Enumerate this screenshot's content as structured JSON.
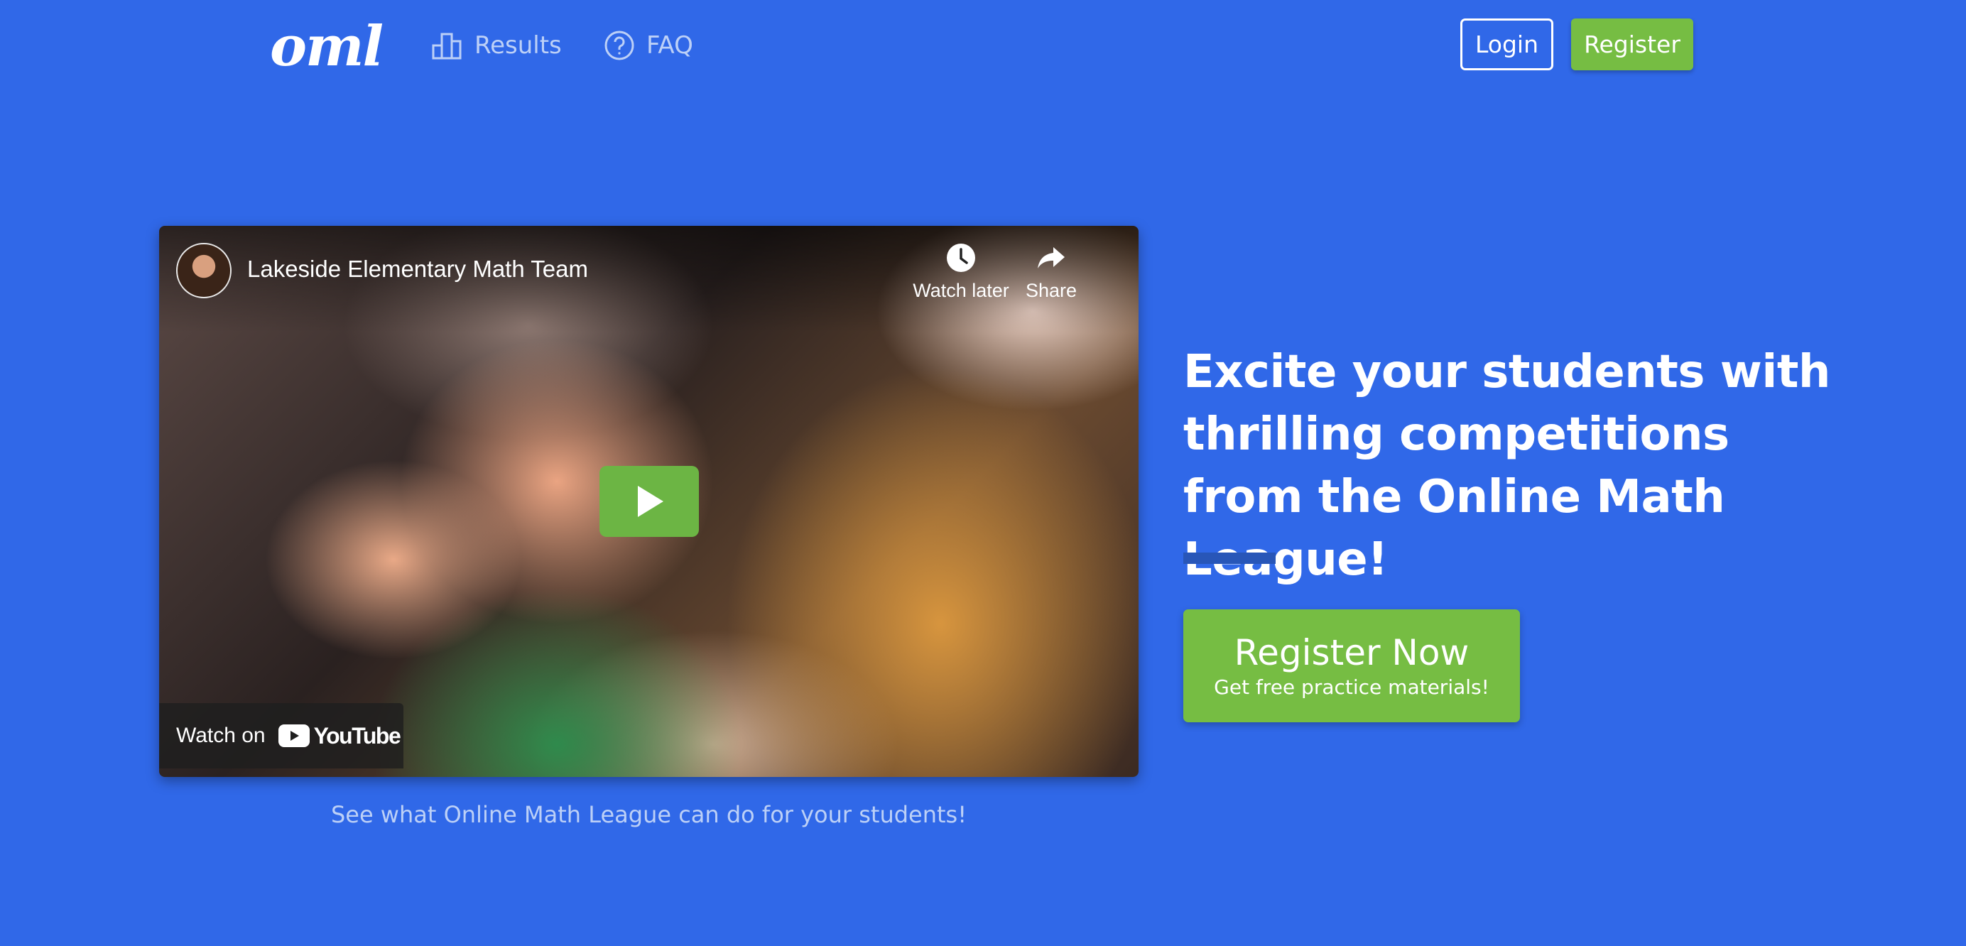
{
  "header": {
    "logo_text": "oml",
    "nav": [
      {
        "label": "Results",
        "icon": "bar-chart-icon"
      },
      {
        "label": "FAQ",
        "icon": "question-circle-icon"
      }
    ],
    "login_label": "Login",
    "register_label": "Register"
  },
  "video": {
    "channel_title": "Lakeside Elementary Math Team",
    "watch_later_label": "Watch later",
    "share_label": "Share",
    "watch_on_label": "Watch on",
    "youtube_label": "YouTube",
    "caption": "See what Online Math League can do for your students!"
  },
  "hero": {
    "headline": "Excite your students with thrilling competitions from the Online Math League!",
    "cta_main": "Register Now",
    "cta_sub": "Get free practice materials!"
  },
  "colors": {
    "background": "#3068e8",
    "accent_green": "#76bd43",
    "nav_text": "#bcd0f7"
  }
}
